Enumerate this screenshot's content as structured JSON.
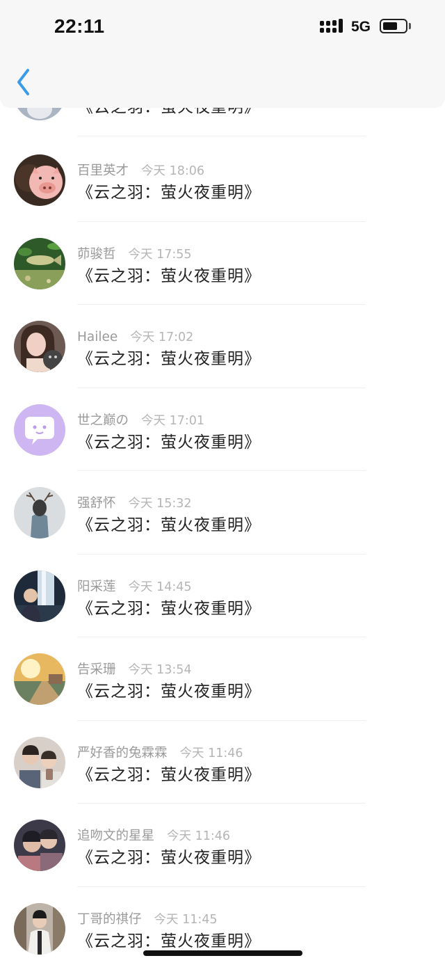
{
  "status_bar": {
    "time": "22:11",
    "network": "5G",
    "battery_level": 0.62
  },
  "nav": {
    "back_icon": "chevron-left-icon",
    "accent_color": "#3a9be8"
  },
  "message_text": "《云之羽：萤火夜重明》",
  "comments": [
    {
      "name": "",
      "time": "",
      "message": "《云之羽：萤火夜重明》",
      "avatar": "partial-avatar"
    },
    {
      "name": "百里英才",
      "time": "今天 18:06",
      "message": "《云之羽：萤火夜重明》",
      "avatar": "pig-avatar"
    },
    {
      "name": "茆骏哲",
      "time": "今天 17:55",
      "message": "《云之羽：萤火夜重明》",
      "avatar": "fish-avatar"
    },
    {
      "name": "Hailee",
      "time": "今天 17:02",
      "message": "《云之羽：萤火夜重明》",
      "avatar": "girl-cat-avatar"
    },
    {
      "name": "世之巅の",
      "time": "今天 17:01",
      "message": "《云之羽：萤火夜重明》",
      "avatar": "chat-bubble-avatar"
    },
    {
      "name": "强舒怀",
      "time": "今天 15:32",
      "message": "《云之羽：萤火夜重明》",
      "avatar": "antler-girl-avatar"
    },
    {
      "name": "阳采莲",
      "time": "今天 14:45",
      "message": "《云之羽：萤火夜重明》",
      "avatar": "waterfall-avatar"
    },
    {
      "name": "告采珊",
      "time": "今天 13:54",
      "message": "《云之羽：萤火夜重明》",
      "avatar": "sunset-road-avatar"
    },
    {
      "name": "严好香的兔霖霖",
      "time": "今天 11:46",
      "message": "《云之羽：萤火夜重明》",
      "avatar": "couple-photo-avatar"
    },
    {
      "name": "追吻文的星星",
      "time": "今天 11:46",
      "message": "《云之羽：萤火夜重明》",
      "avatar": "two-boys-avatar"
    },
    {
      "name": "丁哥的祺仔",
      "time": "今天 11:45",
      "message": "《云之羽：萤火夜重明》",
      "avatar": "costume-avatar"
    }
  ]
}
